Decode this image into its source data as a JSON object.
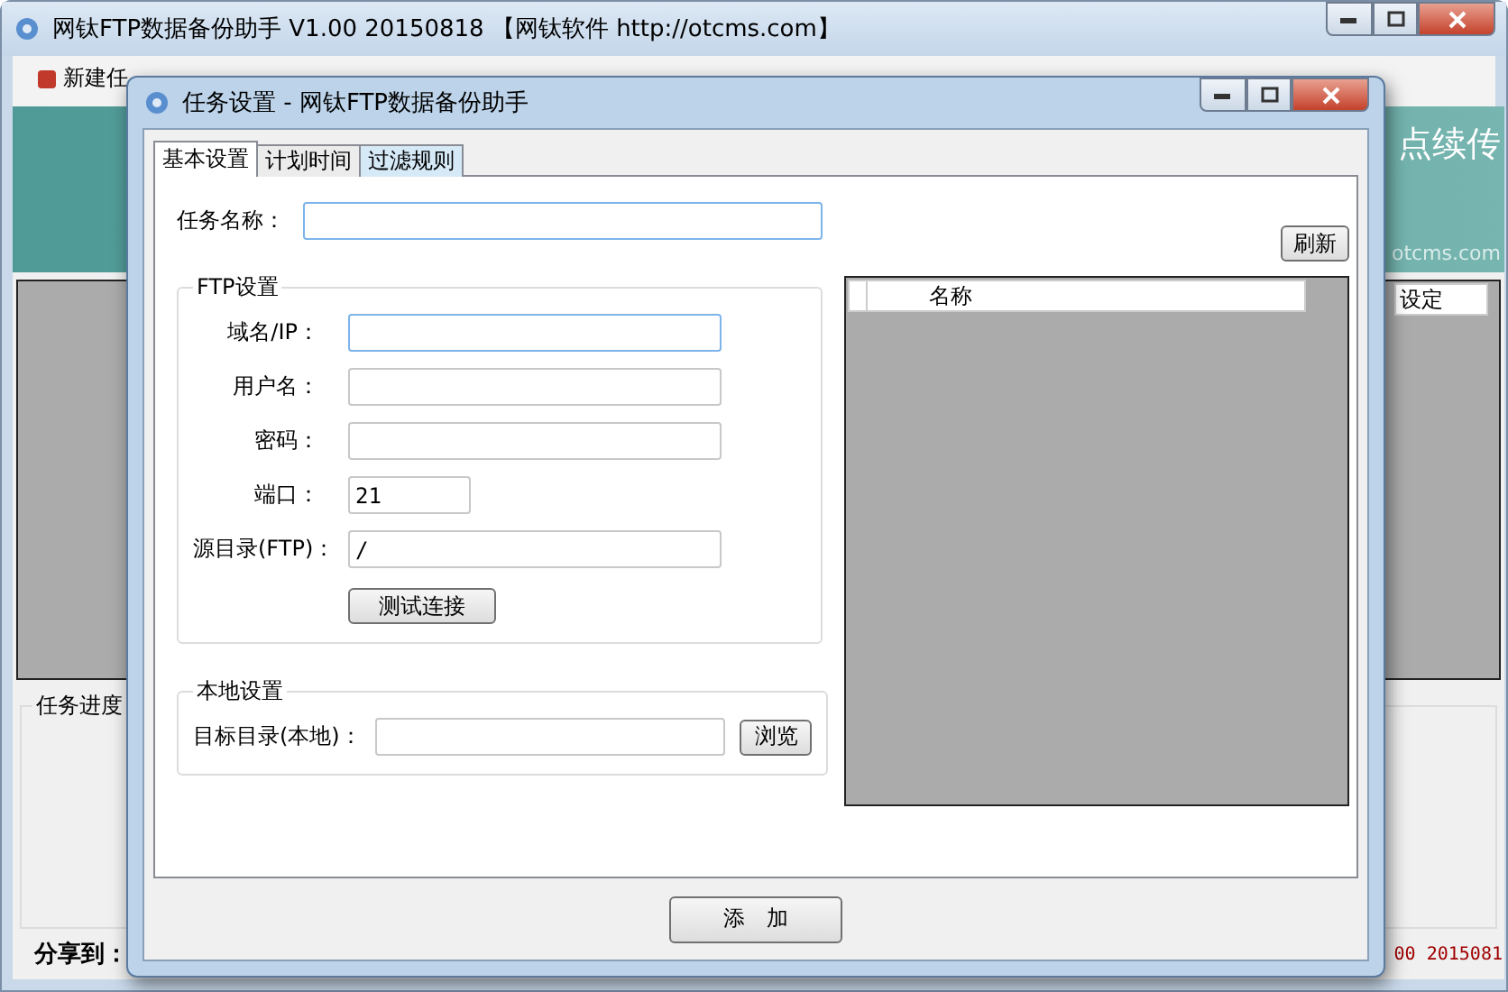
{
  "main_window": {
    "title": "网钛FTP数据备份助手 V1.00 20150818 【网钛软件 http://otcms.com】",
    "menu": [
      {
        "label": "新建任"
      }
    ],
    "banner_text": "点续传",
    "banner_url": "otcms.com",
    "list_column": "设定",
    "progress_group": "任务进度",
    "share_label": "分享到：",
    "status_text": "00 2015081"
  },
  "dialog": {
    "title": "任务设置 - 网钛FTP数据备份助手",
    "tabs": [
      {
        "label": "基本设置",
        "selected": true
      },
      {
        "label": "计划时间",
        "selected": false
      },
      {
        "label": "过滤规则",
        "selected": false
      }
    ],
    "task_name_label": "任务名称：",
    "ftp_group": {
      "title": "FTP设置",
      "fields": [
        {
          "label": "域名/IP：",
          "kind": "long"
        },
        {
          "label": "用户名：",
          "kind": "long"
        },
        {
          "label": "密码：",
          "kind": "long"
        },
        {
          "label": "端口：",
          "kind": "short",
          "value": "21"
        },
        {
          "label": "源目录(FTP)：",
          "kind": "long",
          "value": "/"
        }
      ],
      "test_button": "测试连接"
    },
    "local_group": {
      "title": "本地设置",
      "label": "目标目录(本地)：",
      "browse_button": "浏览"
    },
    "refresh_button": "刷新",
    "list_column": "名称",
    "add_button": "添　加"
  }
}
